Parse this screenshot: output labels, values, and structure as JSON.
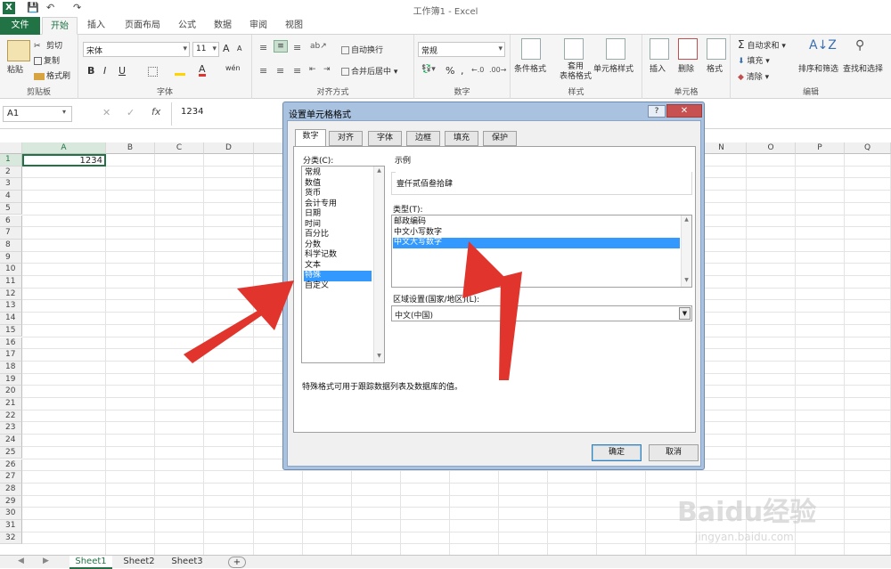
{
  "app": {
    "title": "工作簿1 - Excel"
  },
  "ribbon_tabs": [
    "文件",
    "开始",
    "插入",
    "页面布局",
    "公式",
    "数据",
    "审阅",
    "视图"
  ],
  "clipboard": {
    "paste": "粘贴",
    "cut": "剪切",
    "copy": "复制",
    "format_painter": "格式刷",
    "group": "剪贴板"
  },
  "font": {
    "name": "宋体",
    "size": "11",
    "group": "字体",
    "bold": "B",
    "italic": "I",
    "underline": "U",
    "grow": "A",
    "shrink": "A",
    "text_color_letter": "A",
    "phonetic": "wén"
  },
  "alignment": {
    "wrap": "自动换行",
    "merge": "合并后居中",
    "group": "对齐方式"
  },
  "number": {
    "format": "常规",
    "percent": "%",
    "comma": ",",
    "group": "数字"
  },
  "styles": {
    "conditional": "条件格式",
    "table": "套用\n表格格式",
    "cell": "单元格样式",
    "group": "样式"
  },
  "cells": {
    "insert": "插入",
    "delete": "删除",
    "format": "格式",
    "group": "单元格"
  },
  "editing": {
    "autosum": "自动求和",
    "fill": "填充",
    "clear": "清除",
    "sort": "排序和筛选",
    "find": "查找和选择",
    "group": "编辑"
  },
  "formula_bar": {
    "name_box": "A1",
    "fx": "fx",
    "value": "1234"
  },
  "grid": {
    "columns": [
      "A",
      "B",
      "C",
      "D",
      "",
      "",
      "",
      "",
      "",
      "",
      "",
      "",
      "",
      "N",
      "O",
      "P",
      "Q"
    ],
    "rows": [
      "1",
      "2",
      "3",
      "4",
      "5",
      "6",
      "7",
      "8",
      "9",
      "10",
      "11",
      "12",
      "13",
      "14",
      "15",
      "16",
      "17",
      "18",
      "19",
      "20",
      "21",
      "22",
      "23",
      "24",
      "25",
      "26",
      "27",
      "28",
      "29",
      "30",
      "31",
      "32"
    ],
    "a1_value": "1234"
  },
  "sheets": {
    "tabs": [
      "Sheet1",
      "Sheet2",
      "Sheet3"
    ],
    "add": "+"
  },
  "dialog": {
    "title": "设置单元格格式",
    "help": "?",
    "close": "✕",
    "tabs": [
      "数字",
      "对齐",
      "字体",
      "边框",
      "填充",
      "保护"
    ],
    "category_label": "分类(C):",
    "categories": [
      "常规",
      "数值",
      "货币",
      "会计专用",
      "日期",
      "时间",
      "百分比",
      "分数",
      "科学记数",
      "文本",
      "特殊",
      "自定义"
    ],
    "selected_category": "特殊",
    "sample_label": "示例",
    "sample_value": "壹仟贰佰叁拾肆",
    "type_label": "类型(T):",
    "types": [
      "邮政编码",
      "中文小写数字",
      "中文大写数字"
    ],
    "selected_type": "中文大写数字",
    "locale_label": "区域设置(国家/地区)(L):",
    "locale_value": "中文(中国)",
    "description": "特殊格式可用于跟踪数据列表及数据库的值。",
    "ok": "确定",
    "cancel": "取消"
  },
  "watermark": {
    "text": "Baidu经验",
    "url": "jingyan.baidu.com"
  },
  "colors": {
    "excel_green": "#217346",
    "arrow_red": "#e0342c",
    "selection_blue": "#3399ff"
  }
}
